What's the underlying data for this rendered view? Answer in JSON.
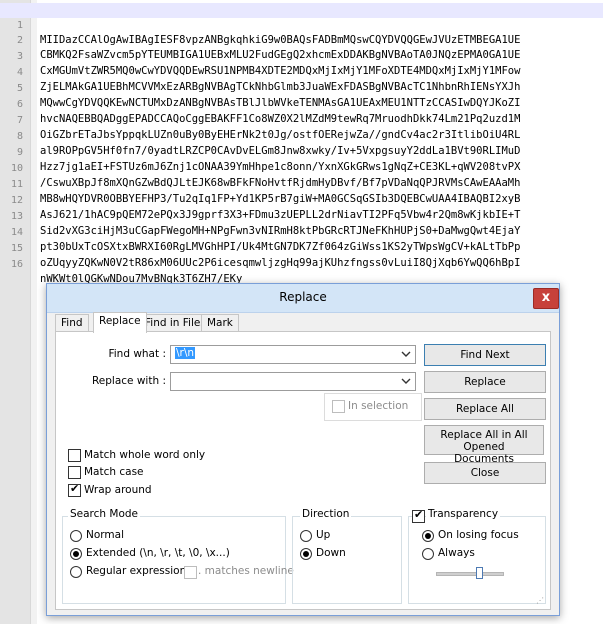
{
  "editor": {
    "lines": [
      {
        "no": "1",
        "text": "MIIDazCCAlOgAwIBAgIESF8vpzANBgkqhkiG9w0BAQsFADBmMQswCQYDVQQGEwJVUzETMBEGA1UE"
      },
      {
        "no": "2",
        "text": "CBMKQ2FsaWZvcm5pYTEUMBIGA1UEBxMLU2FudGEgQ2xhcmExDDAKBgNVBAoTA0JNQzEPMA0GA1UE"
      },
      {
        "no": "3",
        "text": "CxMGUmVtZWR5MQ0wCwYDVQQDEwRSU1NPMB4XDTE2MDQxMjIxMjY1MFoXDTE4MDQxMjIxMjY1MFow"
      },
      {
        "no": "4",
        "text": "ZjELMAkGA1UEBhMCVVMxEzARBgNVBAgTCkNhbGlmb3JuaWExFDASBgNVBAcTC1NhbnRhIENsYXJh"
      },
      {
        "no": "5",
        "text": "MQwwCgYDVQQKEwNCTUMxDzANBgNVBAsTBlJlbWVkeTENMAsGA1UEAxMEU1NTTzCCASIwDQYJKoZI"
      },
      {
        "no": "6",
        "text": "hvcNAQEBBQADggEPADCCAQoCggEBAKFF1Co8WZ0X2lMZdM9tewRq7MruodhDkk74Lm21Pq2uzd1M"
      },
      {
        "no": "7",
        "text": "OiGZbrETaJbsYppqkLUZn0uBy0ByEHErNk2t0Jg/ostfOERejwZa//gndCv4ac2r3ItlibOiU4RL"
      },
      {
        "no": "8",
        "text": "al9ROPpGV5Hf0fn7/0yadtLRZCP0CAvDvELGm8Jnw8xwky/Iv+5VxpgsuyY2ddLa1BVt90RLIMuD"
      },
      {
        "no": "9",
        "text": "Hzz7jg1aEI+FSTUz6mJ6Znj1cONAA39YmHhpe1c8onn/YxnXGkGRws1gNqZ+CE3KL+qWV208tvPX"
      },
      {
        "no": "10",
        "text": "/CswuXBpJf8mXQnGZwBdQJLtEJK68wBFkFNoHvtfRjdmHyDBvf/Bf7pVDaNqQPJRVMsCAwEAAaMh"
      },
      {
        "no": "11",
        "text": "MB8wHQYDVR0OBBYEFHP3/Tu2qIq1FP+Yd1KP5rB7giW+MA0GCSqGSIb3DQEBCwUAA4IBAQBI2xyB"
      },
      {
        "no": "12",
        "text": "AsJ621/1hAC9pQEM72ePQx3J9gprf3X3+FDmu3zUEPLL2drNiavTI2PFq5Vbw4r2Qm8wKjkbIE+T"
      },
      {
        "no": "13",
        "text": "Sid2vXG3ciHjM3uCGapFWegoMH+NPgFwn3vNIRmH8ktPbGRcRTJNeFKhHUPjS0+DaMwgQwt4EjaY"
      },
      {
        "no": "14",
        "text": "pt30bUxTcOSXtxBWRXI60RgLMVGhHPI/Uk4MtGN7DK7Zf064zGiWss1KS2yTWpsWgCV+kALtTbPp"
      },
      {
        "no": "15",
        "text": "oZUqyyZQKwN0V2tR86xM06UUc2P6icesqmwljzgHq99ajKUhzfngss0vLuiI8QjXqb6YwQQ6hBpI"
      },
      {
        "no": "16",
        "text": "nWKWt0lQGKwNDou7MvBNqk3T6ZH7/EKy"
      }
    ]
  },
  "dialog": {
    "title": "Replace",
    "close_glyph": "x",
    "tabs": [
      "Find",
      "Replace",
      "Find in Files",
      "Mark"
    ],
    "find_what_label": "Find what :",
    "find_what_value": "\\r\\n",
    "replace_with_label": "Replace with :",
    "replace_with_value": "",
    "in_selection_label": "In selection",
    "buttons": {
      "find_next": "Find Next",
      "replace": "Replace",
      "replace_all": "Replace All",
      "replace_all_docs_line1": "Replace All in All Opened",
      "replace_all_docs_line2": "Documents",
      "close": "Close"
    },
    "options": {
      "match_whole_word": "Match whole word only",
      "match_whole_word_checked": false,
      "match_case": "Match case",
      "match_case_checked": false,
      "wrap_around": "Wrap around",
      "wrap_around_checked": true
    },
    "search_mode": {
      "title": "Search Mode",
      "normal": "Normal",
      "extended": "Extended (\\n, \\r, \\t, \\0, \\x...)",
      "regex": "Regular expression",
      "matches_newline": ". matches newline",
      "selected": "extended"
    },
    "direction": {
      "title": "Direction",
      "up": "Up",
      "down": "Down",
      "selected": "down"
    },
    "transparency": {
      "title": "Transparency",
      "enabled": true,
      "on_losing_focus": "On losing focus",
      "always": "Always",
      "selected": "on_losing_focus"
    }
  }
}
